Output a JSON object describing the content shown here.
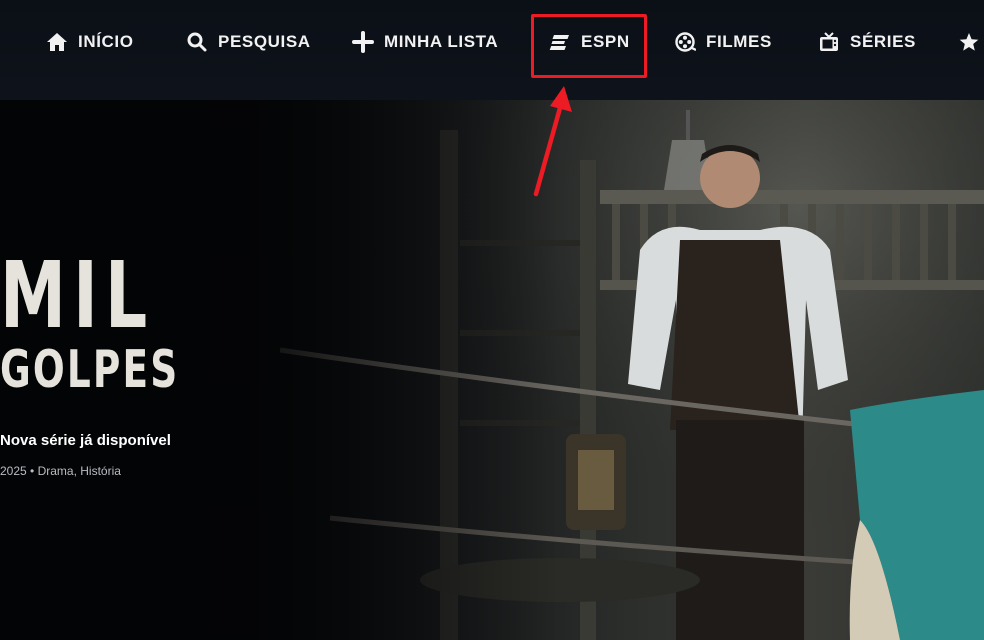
{
  "nav": {
    "items": [
      {
        "label": "INÍCIO",
        "icon": "home-icon"
      },
      {
        "label": "PESQUISA",
        "icon": "search-icon"
      },
      {
        "label": "MINHA LISTA",
        "icon": "plus-icon"
      },
      {
        "label": "ESPN",
        "icon": "espn-icon"
      },
      {
        "label": "FILMES",
        "icon": "film-reel-icon"
      },
      {
        "label": "SÉRIES",
        "icon": "tv-icon"
      },
      {
        "label": "",
        "icon": "star-icon"
      }
    ]
  },
  "hero": {
    "title_line1": "MIL",
    "title_line2": "GOLPES",
    "tagline": "Nova série já disponível",
    "meta": "2025 • Drama, História"
  },
  "colors": {
    "nav_background": "#0e131b",
    "highlight": "#ec1b24",
    "title": "#e6e3dc"
  }
}
